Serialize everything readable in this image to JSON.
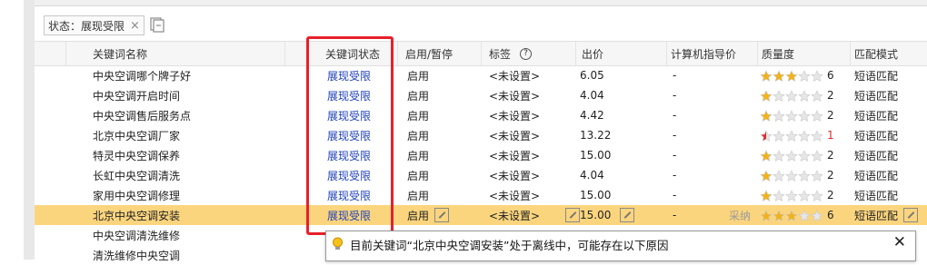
{
  "filter": {
    "chip_label": "状态：展现受限",
    "chip_close": "×"
  },
  "columns": [
    "关键词名称",
    "关键词状态",
    "启用/暂停",
    "标签",
    "出价",
    "计算机指导价",
    "质量度",
    "匹配模式"
  ],
  "tag_help": "?",
  "rows": [
    {
      "name": "中央空调哪个牌子好",
      "status": "展现受限",
      "enable": "启用",
      "tag": "<未设置>",
      "bid": "6.05",
      "guide": "-",
      "quality": 3,
      "quality_text": "6",
      "match": "短语匹配"
    },
    {
      "name": "中央空调开启时间",
      "status": "展现受限",
      "enable": "启用",
      "tag": "<未设置>",
      "bid": "4.04",
      "guide": "-",
      "quality": 1,
      "quality_text": "2",
      "match": "短语匹配"
    },
    {
      "name": "中央空调售后服务点",
      "status": "展现受限",
      "enable": "启用",
      "tag": "<未设置>",
      "bid": "4.42",
      "guide": "-",
      "quality": 1,
      "quality_text": "2",
      "match": "短语匹配"
    },
    {
      "name": "北京中央空调厂家",
      "status": "展现受限",
      "enable": "启用",
      "tag": "<未设置>",
      "bid": "13.22",
      "guide": "-",
      "quality": 0.5,
      "quality_text": "1",
      "match": "短语匹配"
    },
    {
      "name": "特灵中央空调保养",
      "status": "展现受限",
      "enable": "启用",
      "tag": "<未设置>",
      "bid": "15.00",
      "guide": "-",
      "quality": 1,
      "quality_text": "2",
      "match": "短语匹配"
    },
    {
      "name": "长虹中央空调清洗",
      "status": "展现受限",
      "enable": "启用",
      "tag": "<未设置>",
      "bid": "4.04",
      "guide": "-",
      "quality": 1,
      "quality_text": "2",
      "match": "短语匹配"
    },
    {
      "name": "家用中央空调修理",
      "status": "展现受限",
      "enable": "启用",
      "tag": "<未设置>",
      "bid": "15.00",
      "guide": "-",
      "quality": 1,
      "quality_text": "2",
      "match": "短语匹配"
    },
    {
      "name": "北京中央空调安装",
      "status": "展现受限",
      "enable": "启用",
      "tag": "<未设置>",
      "bid": "15.00",
      "guide": "-",
      "quality": 3,
      "quality_text": "6",
      "match": "短语匹配",
      "selected": true,
      "adopt": "采纳"
    },
    {
      "name": "中央空调清洗维修",
      "status": "",
      "enable": "",
      "tag": "",
      "bid": "",
      "guide": "",
      "quality": 0,
      "quality_text": "",
      "match": ""
    },
    {
      "name": "清洗维修中央空调",
      "status": "",
      "enable": "",
      "tag": "",
      "bid": "",
      "guide": "",
      "quality": 0,
      "quality_text": "",
      "match": ""
    }
  ],
  "tooltip": {
    "message": "目前关键词“北京中央空调安装”处于离线中，可能存在以下原因",
    "close": "✕"
  },
  "colors": {
    "selected_row": "#fbd57e",
    "status_text": "#1d3fb8",
    "highlight_box": "#e8202a",
    "star_gold": "#f1b21c",
    "star_red": "#e0292a"
  }
}
